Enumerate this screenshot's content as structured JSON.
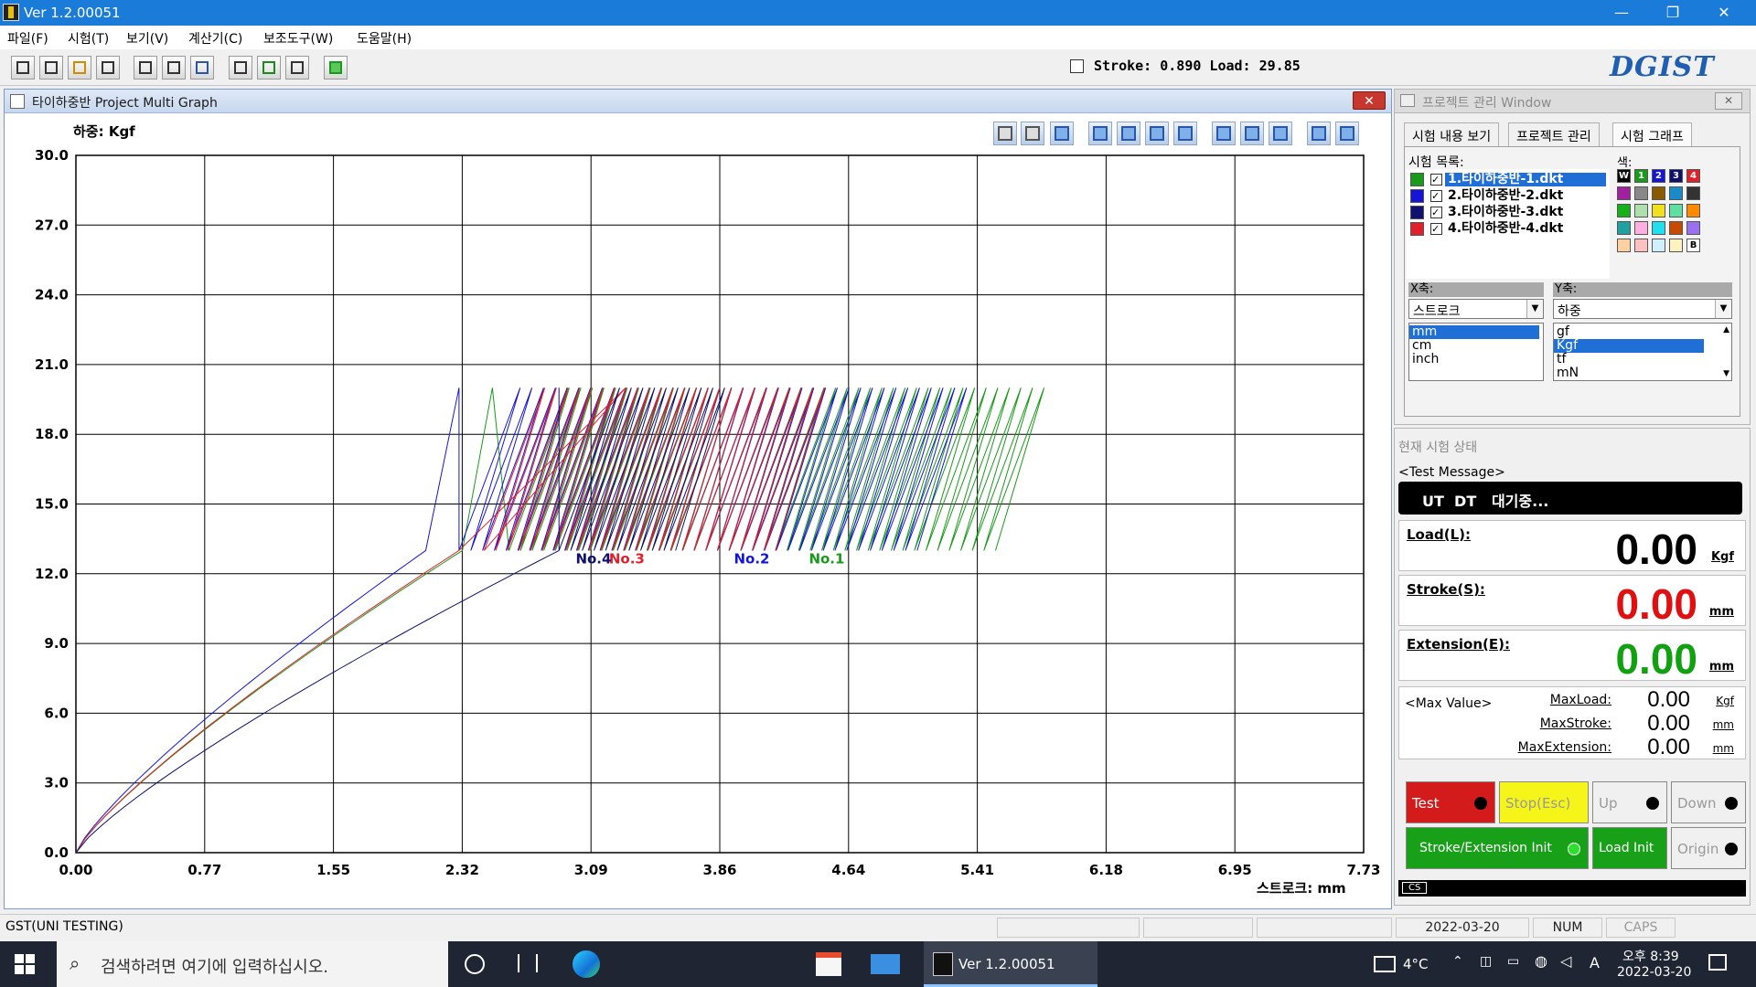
{
  "window": {
    "title": "Ver 1.2.00051",
    "min": "—",
    "restore": "❐",
    "close": "✕"
  },
  "menu": [
    "파일(F)",
    "시험(T)",
    "보기(V)",
    "계산기(C)",
    "보조도구(W)",
    "도움말(H)"
  ],
  "readout": {
    "text": "Stroke: 0.890  Load: 29.85"
  },
  "logo": "DGIST",
  "graph": {
    "title": "타이하중반 Project Multi Graph",
    "close": "✕"
  },
  "chart_data": {
    "type": "line",
    "ylabel": "하중: Kgf",
    "xlabel": "스트로크: mm",
    "xlim": [
      0,
      7.73
    ],
    "ylim": [
      0,
      30
    ],
    "x_ticks": [
      "0.00",
      "0.77",
      "1.55",
      "2.32",
      "3.09",
      "3.86",
      "4.64",
      "5.41",
      "6.18",
      "6.95",
      "7.73"
    ],
    "y_ticks": [
      "0.0",
      "3.0",
      "6.0",
      "9.0",
      "12.0",
      "15.0",
      "18.0",
      "21.0",
      "24.0",
      "27.0",
      "30.0"
    ],
    "grid": true,
    "series": [
      {
        "name": "No.1",
        "color": "#1a9a1a",
        "label_x": 4.4,
        "label_y": 12.6,
        "load_end_x": 2.32,
        "cycle_start": 2.6,
        "cycle_end": 5.52,
        "peak_x": 2.5
      },
      {
        "name": "No.2",
        "color": "#1515d8",
        "label_x": 3.95,
        "label_y": 12.6,
        "load_end_x": 2.1,
        "cycle_start": 2.3,
        "cycle_end": 5.05,
        "peak_x": 2.3
      },
      {
        "name": "No.3",
        "color": "#e0202a",
        "label_x": 3.2,
        "label_y": 12.6,
        "load_end_x": 2.3,
        "cycle_start": 2.45,
        "cycle_end": 4.2,
        "peak_x": 3.3
      },
      {
        "name": "No.4",
        "color": "#10106e",
        "label_x": 3.0,
        "label_y": 12.6,
        "load_end_x": 2.9,
        "cycle_start": 2.9,
        "cycle_end": 3.6,
        "peak_x": 2.9
      }
    ],
    "cycle_min": 13,
    "cycle_max": 20
  },
  "project": {
    "title": "프로젝트 관리 Window",
    "tabs": [
      "시험 내용 보기",
      "프로젝트 관리",
      "시험 그래프"
    ],
    "list_title": "시험 목록:",
    "color_title": "색:",
    "files": [
      {
        "label": "1.타이하중반-1.dkt",
        "color": "#1a9a1a"
      },
      {
        "label": "2.타이하중반-2.dkt",
        "color": "#1515d8"
      },
      {
        "label": "3.타이하중반-3.dkt",
        "color": "#10106e"
      },
      {
        "label": "4.타이하중반-4.dkt",
        "color": "#e0202a"
      }
    ],
    "palette_row1": [
      "W",
      "1",
      "2",
      "3",
      "4"
    ],
    "palette_last": "B",
    "xaxis": {
      "label": "X축:",
      "value": "스트로크",
      "units": [
        "mm",
        "cm",
        "inch"
      ]
    },
    "yaxis": {
      "label": "Y축:",
      "value": "하중",
      "units": [
        "gf",
        "Kgf",
        "tf",
        "mN"
      ]
    }
  },
  "status": {
    "title": "현재 시험 상태",
    "message_label": "<Test Message>",
    "message": "UT  DT   대기중...",
    "load": {
      "label": "Load(L):",
      "value": "0.00",
      "unit": "Kgf"
    },
    "stroke": {
      "label": "Stroke(S):",
      "value": "0.00",
      "unit": "mm"
    },
    "extension": {
      "label": "Extension(E):",
      "value": "0.00",
      "unit": "mm"
    },
    "max_label": "<Max Value>",
    "max": [
      {
        "label": "MaxLoad:",
        "value": "0.00",
        "unit": "Kgf"
      },
      {
        "label": "MaxStroke:",
        "value": "0.00",
        "unit": "mm"
      },
      {
        "label": "MaxExtension:",
        "value": "0.00",
        "unit": "mm"
      }
    ],
    "buttons": {
      "test": "Test",
      "stop": "Stop(Esc)",
      "up": "Up",
      "down": "Down",
      "init": "Stroke/Extension Init",
      "loadinit": "Load Init",
      "origin": "Origin"
    },
    "cs": "CS"
  },
  "statusbar": {
    "left": "GST(UNI TESTING)",
    "date": "2022-03-20",
    "num": "NUM",
    "caps": "CAPS"
  },
  "taskbar": {
    "search": "검색하려면 여기에 입력하십시오.",
    "app": "Ver 1.2.00051",
    "temp": "4°C",
    "time": "오후 8:39",
    "date": "2022-03-20",
    "ime": "A"
  }
}
